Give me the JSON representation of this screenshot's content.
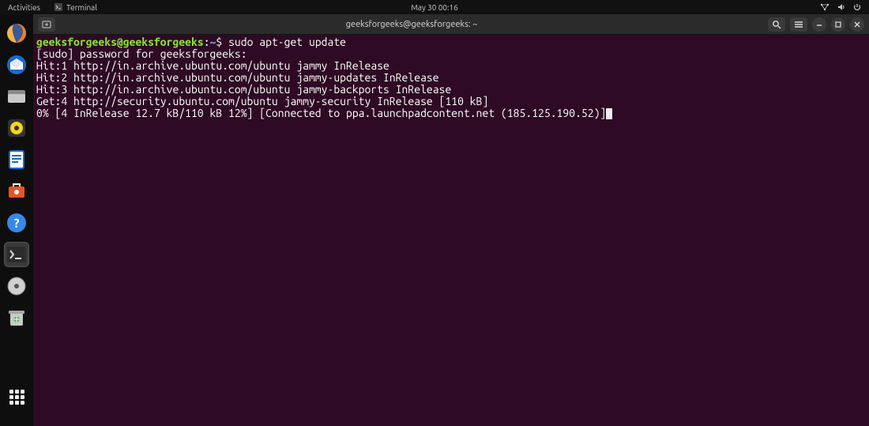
{
  "topbar": {
    "activities": "Activities",
    "terminal_menu": "Terminal",
    "datetime": "May 30  00:16"
  },
  "dock": {
    "items": [
      {
        "name": "firefox-icon"
      },
      {
        "name": "thunderbird-icon"
      },
      {
        "name": "files-icon"
      },
      {
        "name": "rhythmbox-icon"
      },
      {
        "name": "writer-icon"
      },
      {
        "name": "software-icon"
      },
      {
        "name": "help-icon"
      },
      {
        "name": "terminal-icon"
      },
      {
        "name": "disc-icon"
      },
      {
        "name": "trash-icon"
      }
    ]
  },
  "terminal": {
    "title": "geeksforgeeks@geeksforgeeks: ~",
    "prompt": {
      "userhost": "geeksforgeeks@geeksforgeeks",
      "path": "~",
      "symbol": "$"
    },
    "command": "sudo apt-get update",
    "output": [
      "[sudo] password for geeksforgeeks: ",
      "Hit:1 http://in.archive.ubuntu.com/ubuntu jammy InRelease",
      "Hit:2 http://in.archive.ubuntu.com/ubuntu jammy-updates InRelease",
      "Hit:3 http://in.archive.ubuntu.com/ubuntu jammy-backports InRelease",
      "Get:4 http://security.ubuntu.com/ubuntu jammy-security InRelease [110 kB]",
      "0% [4 InRelease 12.7 kB/110 kB 12%] [Connected to ppa.launchpadcontent.net (185.125.190.52)]"
    ]
  }
}
